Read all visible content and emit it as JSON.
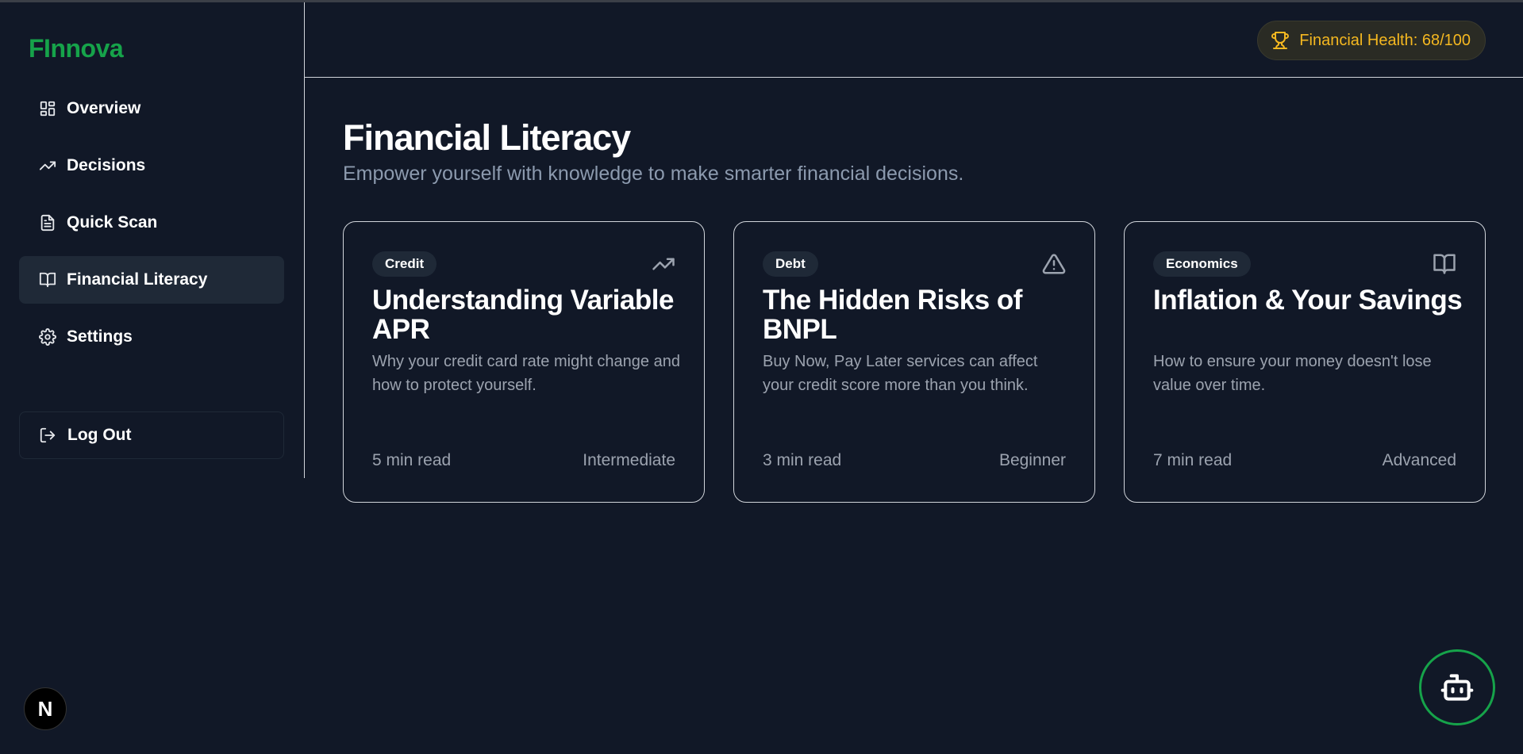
{
  "app": {
    "logo": "FInnova"
  },
  "sidebar": {
    "items": [
      {
        "label": "Overview",
        "icon": "grid-icon",
        "active": false
      },
      {
        "label": "Decisions",
        "icon": "trending-up-icon",
        "active": false
      },
      {
        "label": "Quick Scan",
        "icon": "file-text-icon",
        "active": false
      },
      {
        "label": "Financial Literacy",
        "icon": "book-open-icon",
        "active": true
      },
      {
        "label": "Settings",
        "icon": "gear-icon",
        "active": false
      }
    ],
    "logout_label": "Log Out"
  },
  "header": {
    "health_label": "Financial Health: 68/100",
    "health_icon": "trophy-icon"
  },
  "main": {
    "title": "Financial Literacy",
    "subtitle": "Empower yourself with knowledge to make smarter financial decisions.",
    "cards": [
      {
        "tag": "Credit",
        "icon": "trending-up-icon",
        "title": "Understanding Variable APR",
        "description": "Why your credit card rate might change and how to protect yourself.",
        "read_time": "5 min read",
        "level": "Intermediate"
      },
      {
        "tag": "Debt",
        "icon": "warning-icon",
        "title": "The Hidden Risks of BNPL",
        "description": "Buy Now, Pay Later services can affect your credit score more than you think.",
        "read_time": "3 min read",
        "level": "Beginner"
      },
      {
        "tag": "Economics",
        "icon": "book-open-icon",
        "title": "Inflation & Your Savings",
        "description": "How to ensure your money doesn't lose value over time.",
        "read_time": "7 min read",
        "level": "Advanced"
      }
    ]
  },
  "floating": {
    "bot_icon": "bot-icon",
    "dev_badge": "N"
  },
  "colors": {
    "background": "#111827",
    "brand": "#16a34a",
    "health": "#f5b820",
    "muted": "#9ca3af"
  }
}
